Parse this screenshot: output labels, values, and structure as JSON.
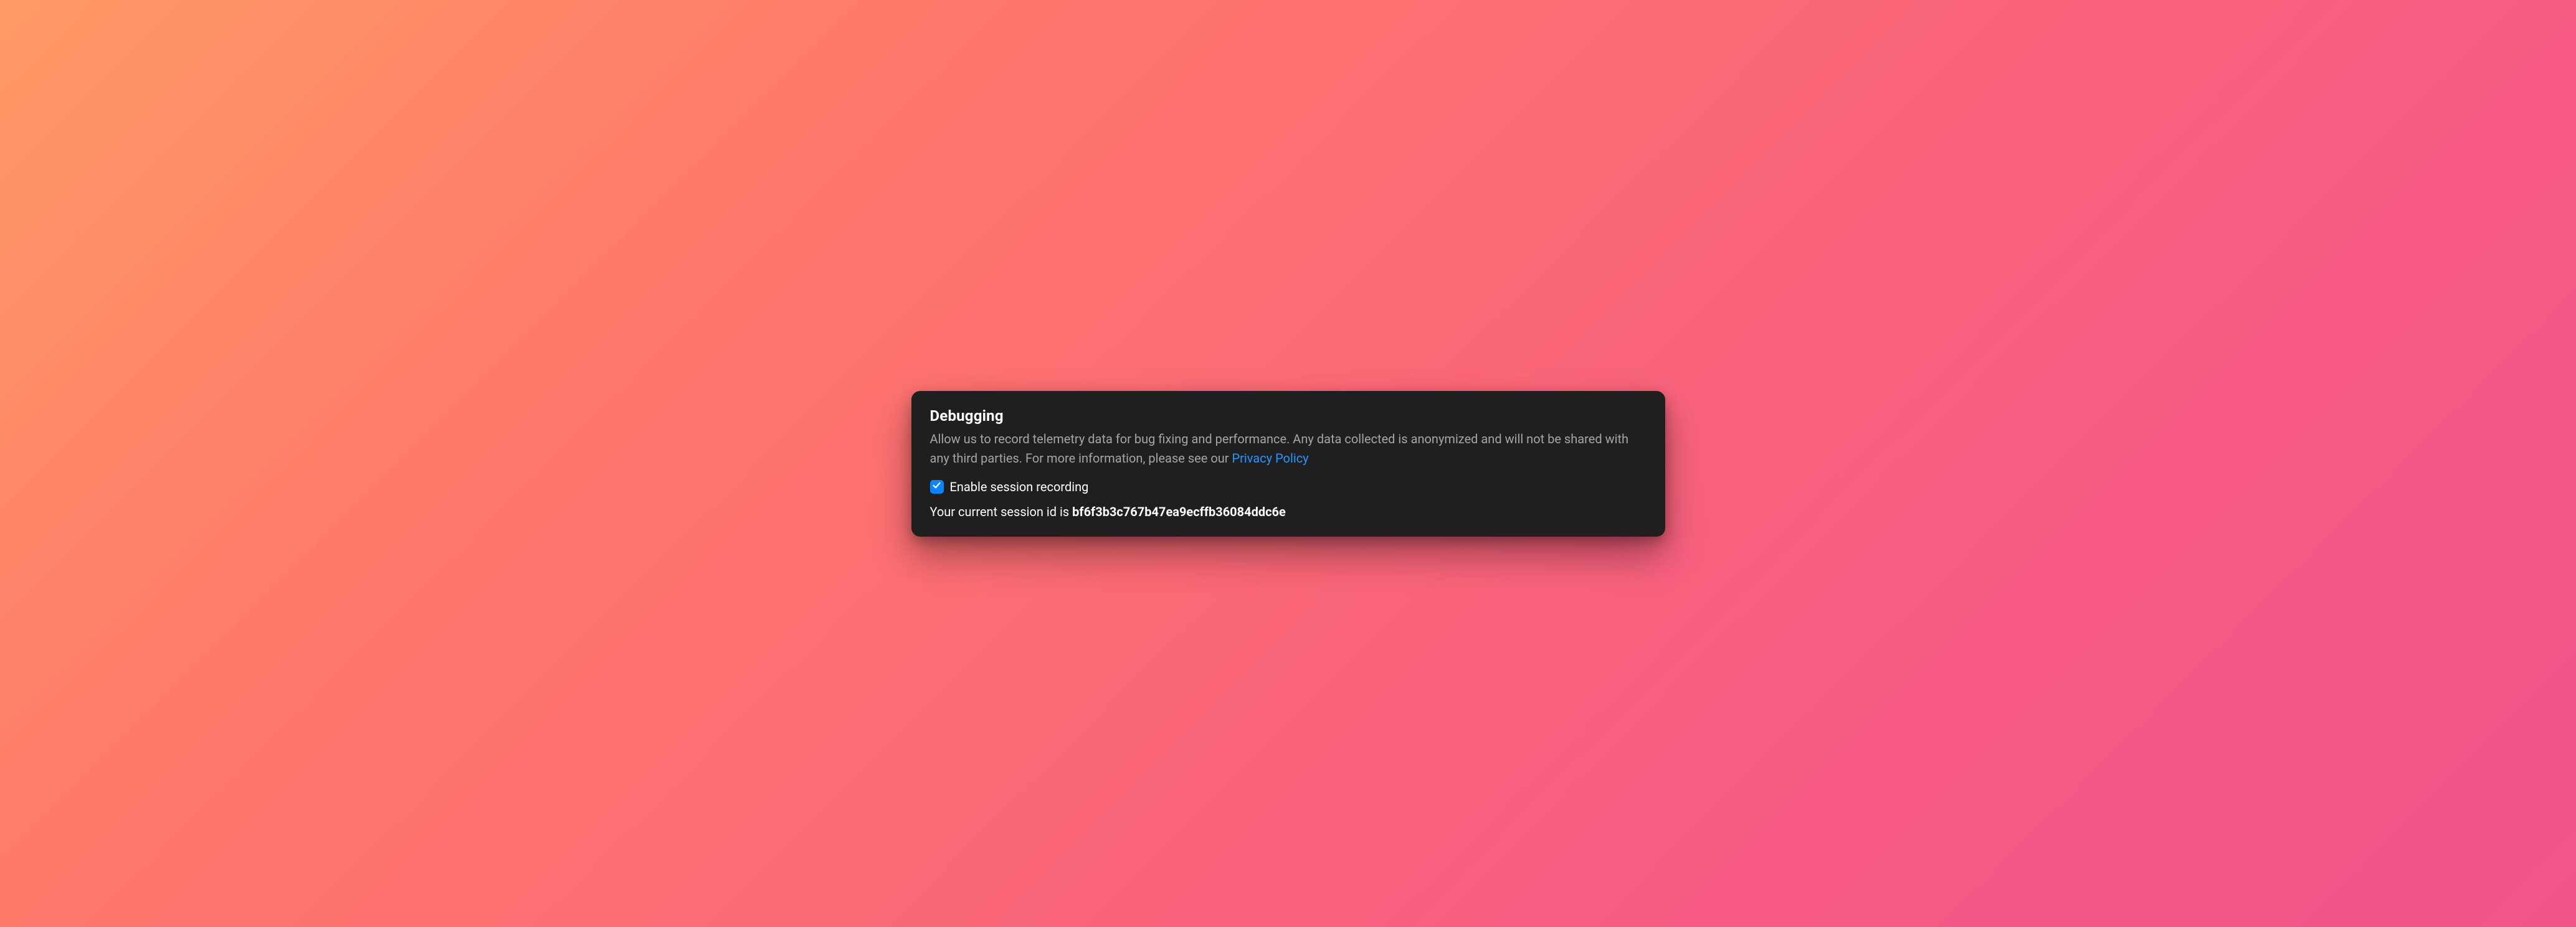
{
  "card": {
    "title": "Debugging",
    "description_prefix": "Allow us to record telemetry data for bug fixing and performance. Any data collected is anonymized and will not be shared with any third parties. For more information, please see our ",
    "privacy_link_label": "Privacy Policy",
    "checkbox": {
      "checked": true,
      "label": "Enable session recording"
    },
    "session_prefix": "Your current session id is ",
    "session_id": "bf6f3b3c767b47ea9ecffb36084ddc6e"
  },
  "colors": {
    "accent": "#0a84ff",
    "link": "#2997ff",
    "card_bg": "#1f1f1f"
  }
}
